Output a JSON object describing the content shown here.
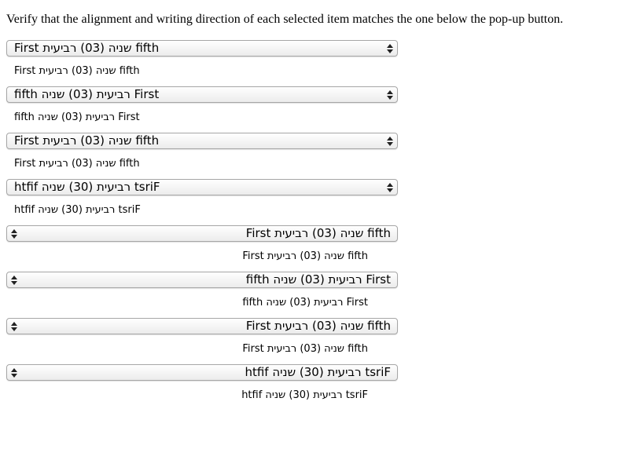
{
  "instruction": "Verify that the alignment and writing direction of each selected item matches the one below the pop-up button.",
  "rows": [
    {
      "selected": "First שניה (03) רביעית fifth",
      "reference": "First שניה (03) רביעית fifth"
    },
    {
      "selected": "fifth רביעית (03) שניה First",
      "reference": "fifth רביעית (03) שניה First"
    },
    {
      "selected": "First תיעיבר (03) הינש fifth",
      "reference": "First תיעיבר (03) הינש fifth"
    },
    {
      "selected": "htfif רביעית (30) שניה tsriF",
      "reference": "htfif רביעית (30) שניה tsriF"
    },
    {
      "selected": "First שניה (03) רביעית fifth",
      "reference": "First שניה (03) רביעית fifth"
    },
    {
      "selected": "fifth רביעית (03) שניה First",
      "reference": "fifth רביעית (03) שניה First"
    },
    {
      "selected": "First תיעיבר (03) הינש fifth",
      "reference": "First תיעיבר (03) הינש fifth"
    },
    {
      "selected": "htfif רביעית (30) שניה tsriF",
      "reference": "htfif רביעית (30) שניה tsriF"
    }
  ]
}
